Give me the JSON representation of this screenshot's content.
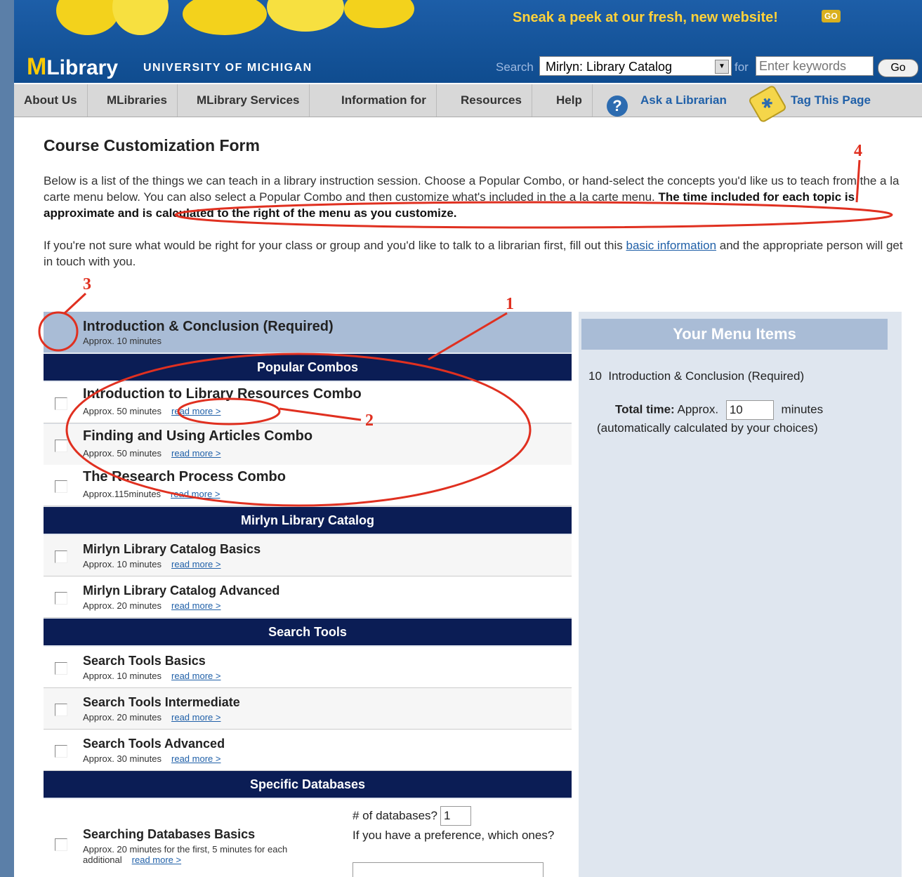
{
  "header": {
    "promo_text": "Sneak a peek at our fresh, new website!",
    "promo_go": "GO",
    "logo_m": "M",
    "logo_text": "Library",
    "university": "UNIVERSITY OF MICHIGAN",
    "search_label": "Search",
    "search_scope": "Mirlyn: Library Catalog",
    "for_label": "for",
    "keyword_placeholder": "Enter keywords",
    "go_label": "Go"
  },
  "nav": {
    "items": [
      "About Us",
      "MLibraries",
      "MLibrary Services",
      "Information for",
      "Resources",
      "Help"
    ],
    "ask_librarian": "Ask a Librarian",
    "tag_page": "Tag This Page"
  },
  "page": {
    "title": "Course Customization Form",
    "intro_1": "Below is a list of the things we can teach in a library instruction session. Choose a Popular Combo, or hand-select the concepts you'd like us to teach from the a la carte menu below. You can also select a Popular Combo and then customize what's included in the a la carte menu. ",
    "intro_bold": "The time included for each topic is approximate and is calculated to the right of the menu as you customize.",
    "intro_2": "If you're not sure what would be right for your class or group and you'd like to talk to a librarian first, fill out this ",
    "intro_link": "basic information",
    "intro_3": " and the appropriate person will get in touch with you."
  },
  "menu": {
    "required_title": "Introduction & Conclusion (Required)",
    "required_time": "Approx. 10 minutes",
    "read_more": "read more >",
    "sections": [
      {
        "heading": "Popular Combos",
        "items": [
          {
            "title": "Introduction to Library Resources Combo",
            "time": "Approx. 50 minutes"
          },
          {
            "title": "Finding and Using Articles Combo",
            "time": "Approx. 50 minutes"
          },
          {
            "title": "The Research Process Combo",
            "time": "Approx.115minutes"
          }
        ]
      },
      {
        "heading": "Mirlyn Library Catalog",
        "items": [
          {
            "title": "Mirlyn Library Catalog Basics",
            "time": "Approx. 10 minutes"
          },
          {
            "title": "Mirlyn Library Catalog Advanced",
            "time": "Approx. 20 minutes"
          }
        ]
      },
      {
        "heading": "Search Tools",
        "items": [
          {
            "title": "Search Tools Basics",
            "time": "Approx. 10 minutes"
          },
          {
            "title": "Search Tools Intermediate",
            "time": "Approx. 20 minutes"
          },
          {
            "title": "Search Tools Advanced",
            "time": "Approx. 30 minutes"
          }
        ]
      },
      {
        "heading": "Specific Databases",
        "items": [
          {
            "title": "Searching Databases Basics",
            "time": "Approx. 20 minutes for the first, 5 minutes for each additional"
          }
        ]
      }
    ],
    "db_question": "# of databases?",
    "db_count": "1",
    "db_pref": "If you have a preference, which ones?"
  },
  "your_menu": {
    "heading": "Your Menu Items",
    "item_minutes": "10",
    "item_name": "Introduction & Conclusion (Required)",
    "total_label": "Total time:",
    "approx": "Approx.",
    "total_value": "10",
    "minutes": "minutes",
    "note": "(automatically calculated by your choices)"
  },
  "annotations": [
    "1",
    "2",
    "3",
    "4"
  ],
  "colors": {
    "annotation": "#e03020",
    "section_header": "#0b1d55",
    "nav_link": "#2060a8"
  }
}
